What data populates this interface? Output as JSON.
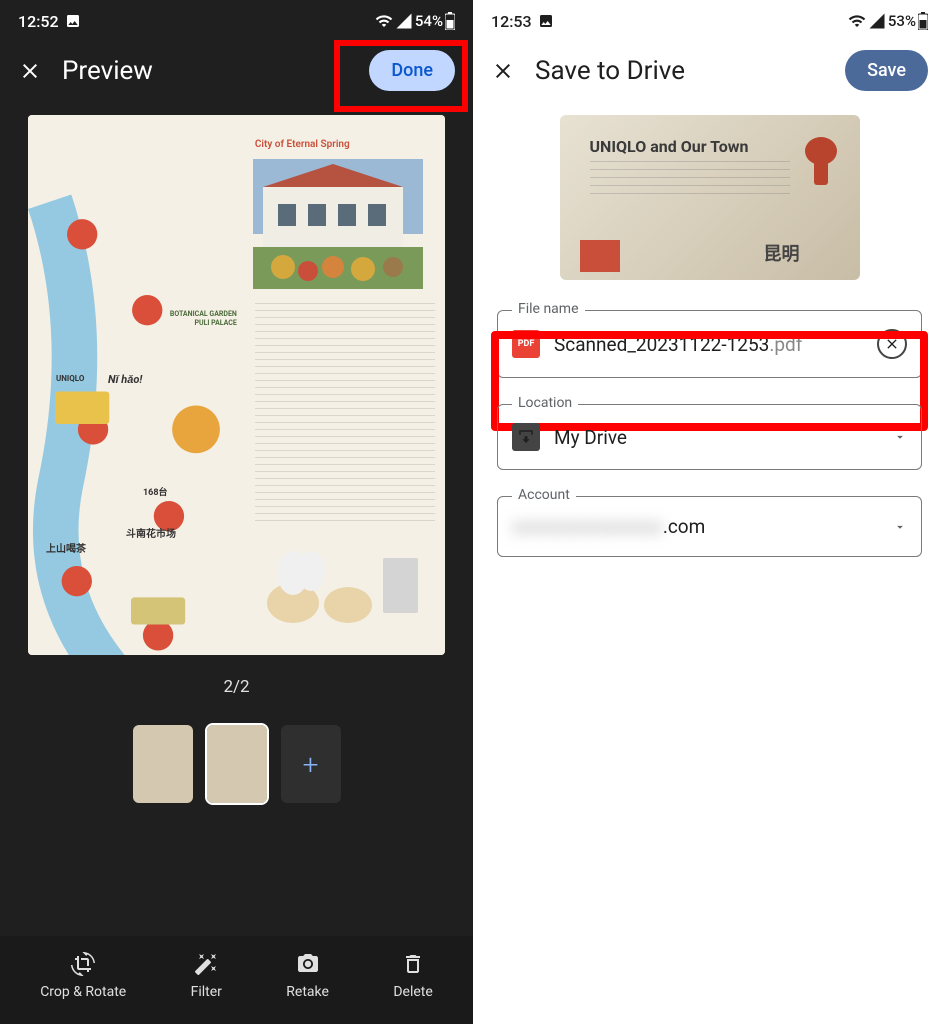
{
  "left": {
    "status": {
      "time": "12:52",
      "battery": "54%"
    },
    "title": "Preview",
    "done": "Done",
    "counter": "2/2",
    "preview_heading": "City of Eternal Spring",
    "map_labels": [
      "BOTANICAL GARDEN",
      "PULI PALACE",
      "UNIQLO",
      "Nǐ hǎo!",
      "上山喝茶",
      "斗南花市场",
      "168台"
    ],
    "bottom": {
      "crop": "Crop & Rotate",
      "filter": "Filter",
      "retake": "Retake",
      "delete": "Delete"
    }
  },
  "right": {
    "status": {
      "time": "12:53",
      "battery": "53%"
    },
    "title": "Save to Drive",
    "save": "Save",
    "preview_title": "UNIQLO and Our Town",
    "preview_sub": "昆明",
    "filename_label": "File name",
    "filename": "Scanned_20231122-1253",
    "ext": ".pdf",
    "pdf_badge": "PDF",
    "location_label": "Location",
    "location": "My Drive",
    "account_label": "Account",
    "account_suffix": ".com"
  }
}
